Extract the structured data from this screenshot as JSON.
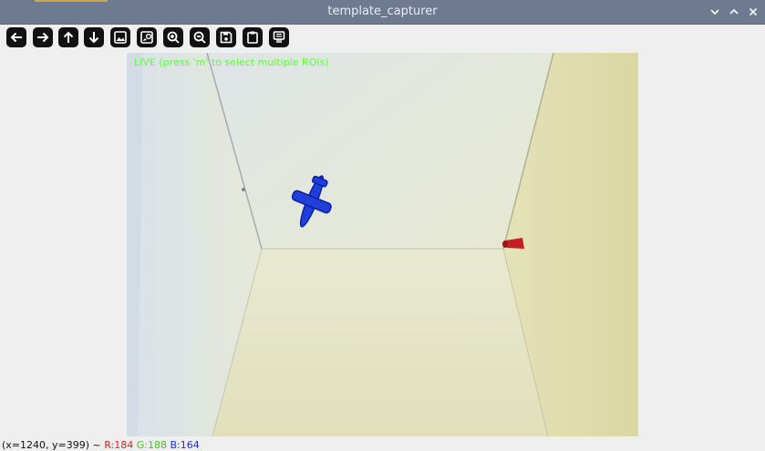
{
  "window": {
    "title": "template_capturer",
    "controls": [
      "chevron-down-icon",
      "chevron-up-icon",
      "close-icon"
    ]
  },
  "toolbar": {
    "buttons": [
      {
        "name": "pan-left-button",
        "icon": "arrow-left-icon"
      },
      {
        "name": "pan-right-button",
        "icon": "arrow-right-icon"
      },
      {
        "name": "pan-up-button",
        "icon": "arrow-up-icon"
      },
      {
        "name": "pan-down-button",
        "icon": "arrow-down-icon"
      },
      {
        "name": "zoom-reset-button",
        "icon": "image-icon"
      },
      {
        "name": "zoom-original-button",
        "icon": "image-zoom-icon"
      },
      {
        "name": "zoom-in-button",
        "icon": "zoom-in-icon"
      },
      {
        "name": "zoom-out-button",
        "icon": "zoom-out-icon"
      },
      {
        "name": "save-button",
        "icon": "save-icon"
      },
      {
        "name": "copy-button",
        "icon": "clipboard-icon"
      },
      {
        "name": "properties-button",
        "icon": "properties-icon"
      }
    ]
  },
  "overlay": {
    "text": "LIVE (press 'm' to select multiple ROIs)",
    "color": "#5cff38"
  },
  "status": {
    "coords": "(x=1240, y=399) ~",
    "r": "R:184",
    "g": "G:188",
    "b": "B:164"
  }
}
